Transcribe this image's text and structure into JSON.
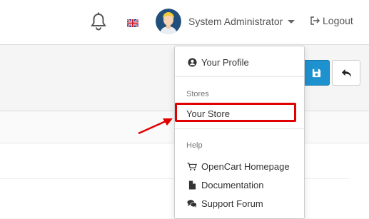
{
  "header": {
    "user_name": "System Administrator",
    "logout_label": "Logout"
  },
  "dropdown": {
    "profile_label": "Your Profile",
    "stores_header": "Stores",
    "store_label": "Your Store",
    "help_header": "Help",
    "help_items": [
      {
        "label": "OpenCart Homepage",
        "icon": "cart-icon"
      },
      {
        "label": "Documentation",
        "icon": "file-icon"
      },
      {
        "label": "Support Forum",
        "icon": "comments-icon"
      }
    ]
  },
  "colors": {
    "primary": "#1e91cf",
    "highlight": "#e00000"
  }
}
